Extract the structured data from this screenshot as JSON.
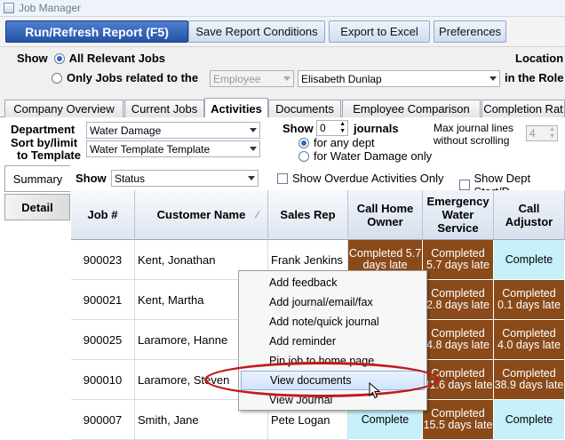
{
  "window": {
    "title": "Job Manager"
  },
  "toolbar": {
    "run": "Run/Refresh Report (F5)",
    "save": "Save Report Conditions",
    "export": "Export to Excel",
    "preferences": "Preferences"
  },
  "filter": {
    "show_label": "Show",
    "all_jobs": "All Relevant Jobs",
    "only_jobs": "Only Jobs related to the",
    "employee_role_value": "Employee",
    "employee_value": "Elisabeth Dunlap",
    "in_role_label": "in the Role",
    "location_label": "Location"
  },
  "tabs": [
    "Company Overview",
    "Current Jobs",
    "Activities",
    "Documents",
    "Employee Comparison",
    "Completion Rat"
  ],
  "options": {
    "department_label": "Department",
    "department_value": "Water Damage",
    "sort_label_1": "Sort by/limit",
    "sort_label_2": "to Template",
    "template_value": "Water Template Template",
    "show_label": "Show",
    "journals_count": "0",
    "journals_label": "journals",
    "any_dept": "for any dept",
    "water_only": "for Water Damage only",
    "max_lines_1": "Max journal lines",
    "max_lines_2": "without scrolling",
    "max_lines_value": "4"
  },
  "side_tabs": {
    "summary": "Summary",
    "detail": "Detail"
  },
  "grid_options": {
    "show_label": "Show",
    "status_value": "Status",
    "overdue_only": "Show Overdue Activities Only",
    "dept_dates": "Show Dept Start/D"
  },
  "table": {
    "headers": [
      "Job #",
      "Customer Name",
      "Sales Rep",
      "Call Home Owner",
      "Emergency Water Service",
      "Call Adjustor"
    ],
    "rows": [
      {
        "job": "900023",
        "customer": "Kent, Jonathan",
        "rep": "Frank Jenkins",
        "s1": "Completed 5.7 days late",
        "s2": "Completed 5.7 days late",
        "s3": "Complete"
      },
      {
        "job": "900021",
        "customer": "Kent, Martha",
        "rep": "",
        "s1": "",
        "s2": "Completed 2.8 days late",
        "s3": "Completed 0.1 days late"
      },
      {
        "job": "900025",
        "customer": "Laramore, Hanne",
        "rep": "",
        "s1": "",
        "s2": "Completed 4.8 days late",
        "s3": "Completed 4.0 days late"
      },
      {
        "job": "900010",
        "customer": "Laramore, Steven",
        "rep": "",
        "s1": "",
        "s2": "Completed 41.6 days late",
        "s3": "Completed 38.9 days late"
      },
      {
        "job": "900007",
        "customer": "Smith, Jane",
        "rep": "Pete Logan",
        "s1": "Complete",
        "s2": "Completed 15.5 days late",
        "s3": "Complete"
      }
    ]
  },
  "context_menu": {
    "items": [
      "Add feedback",
      "Add journal/email/fax",
      "Add note/quick journal",
      "Add reminder",
      "Pin job to home page",
      "View documents",
      "View Journal"
    ]
  },
  "colors": {
    "late": "#8a4a1a",
    "ok": "#c6f1fb",
    "highlight": "#c11a1a"
  }
}
